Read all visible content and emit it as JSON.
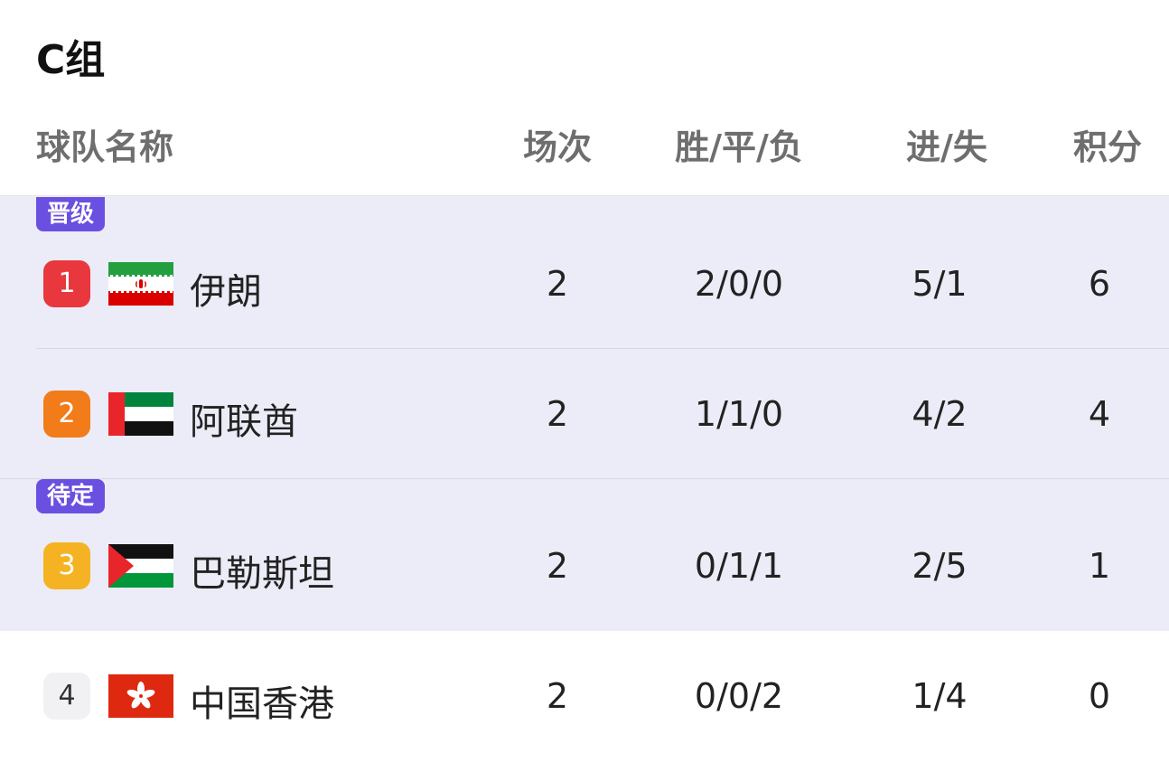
{
  "group_title": "C组",
  "columns": {
    "team": "球队名称",
    "played": "场次",
    "wdl": "胜/平/负",
    "goals": "进/失",
    "points": "积分"
  },
  "zones": {
    "promoted": "晋级",
    "pending": "待定"
  },
  "teams": [
    {
      "rank": "1",
      "rank_color": "#e8383d",
      "name": "伊朗",
      "flag": "iran-flag-icon",
      "played": "2",
      "wdl": "2/0/0",
      "goals": "5/1",
      "points": "6"
    },
    {
      "rank": "2",
      "rank_color": "#f27b1a",
      "name": "阿联酋",
      "flag": "uae-flag-icon",
      "played": "2",
      "wdl": "1/1/0",
      "goals": "4/2",
      "points": "4"
    },
    {
      "rank": "3",
      "rank_color": "#f5b324",
      "name": "巴勒斯坦",
      "flag": "palestine-flag-icon",
      "played": "2",
      "wdl": "0/1/1",
      "goals": "2/5",
      "points": "1"
    },
    {
      "rank": "4",
      "rank_color": "#f1f1f4",
      "name": "中国香港",
      "flag": "hong-kong-flag-icon",
      "played": "2",
      "wdl": "0/0/2",
      "goals": "1/4",
      "points": "0"
    }
  ],
  "colors": {
    "promoted_bg": "#ececf8",
    "tag_bg": "#6a4fe0"
  }
}
